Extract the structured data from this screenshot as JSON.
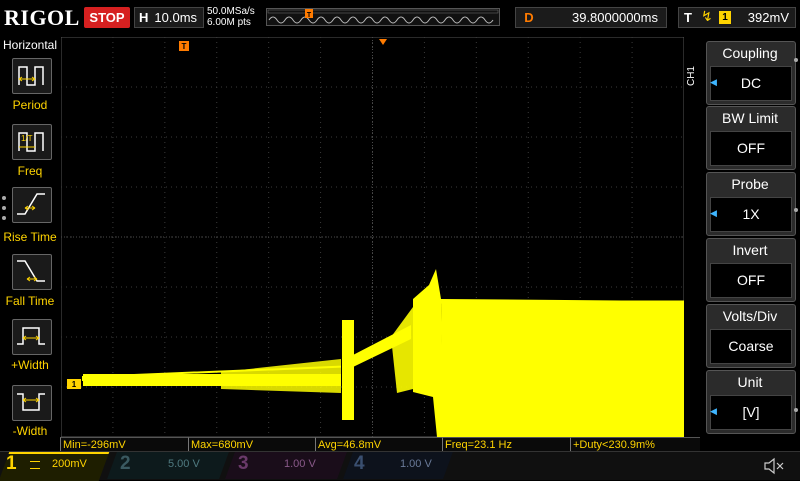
{
  "header": {
    "logo": "RIGOL",
    "run_status": "STOP",
    "timebase_label": "H",
    "timebase_value": "10.0ms",
    "sample_rate": "50.0MSa/s",
    "memory_depth": "6.00M pts",
    "delay_label": "D",
    "delay_value": "39.8000000ms",
    "trigger_label": "T",
    "trigger_source": "1",
    "trigger_level": "392mV"
  },
  "left_panel": {
    "title": "Horizontal",
    "items": [
      {
        "label": "Period",
        "icon": "period-icon"
      },
      {
        "label": "Freq",
        "icon": "freq-icon"
      },
      {
        "label": "Rise Time",
        "icon": "rise-time-icon"
      },
      {
        "label": "Fall Time",
        "icon": "fall-time-icon"
      },
      {
        "label": "+Width",
        "icon": "positive-width-icon"
      },
      {
        "label": "-Width",
        "icon": "negative-width-icon"
      }
    ]
  },
  "right_panel": {
    "channel_label": "CH1",
    "items": [
      {
        "title": "Coupling",
        "value": "DC"
      },
      {
        "title": "BW Limit",
        "value": "OFF"
      },
      {
        "title": "Probe",
        "value": "1X"
      },
      {
        "title": "Invert",
        "value": "OFF"
      },
      {
        "title": "Volts/Div",
        "value": "Coarse"
      },
      {
        "title": "Unit",
        "value": "[V]"
      }
    ]
  },
  "measurements": [
    "Min=-296mV",
    "Max=680mV",
    "Avg=46.8mV",
    "Freq=23.1 Hz",
    "+Duty<230.9m%"
  ],
  "channels": [
    {
      "num": "1",
      "scale": "200mV",
      "color": "#ffd400",
      "active": true
    },
    {
      "num": "2",
      "scale": "5.00 V",
      "color": "#22d3e6",
      "active": false
    },
    {
      "num": "3",
      "scale": "1.00 V",
      "color": "#e040e0",
      "active": false
    },
    {
      "num": "4",
      "scale": "1.00 V",
      "color": "#3a7bff",
      "active": false
    }
  ],
  "markers": {
    "ch1_ground": "1",
    "trigger_pos": "T"
  },
  "colors": {
    "trace": "#ffff00",
    "trigger": "#ff7b00",
    "grid": "#3a3a3a",
    "accent": "#3fb6ff"
  },
  "icons": {
    "speaker": "speaker-mute-icon"
  }
}
